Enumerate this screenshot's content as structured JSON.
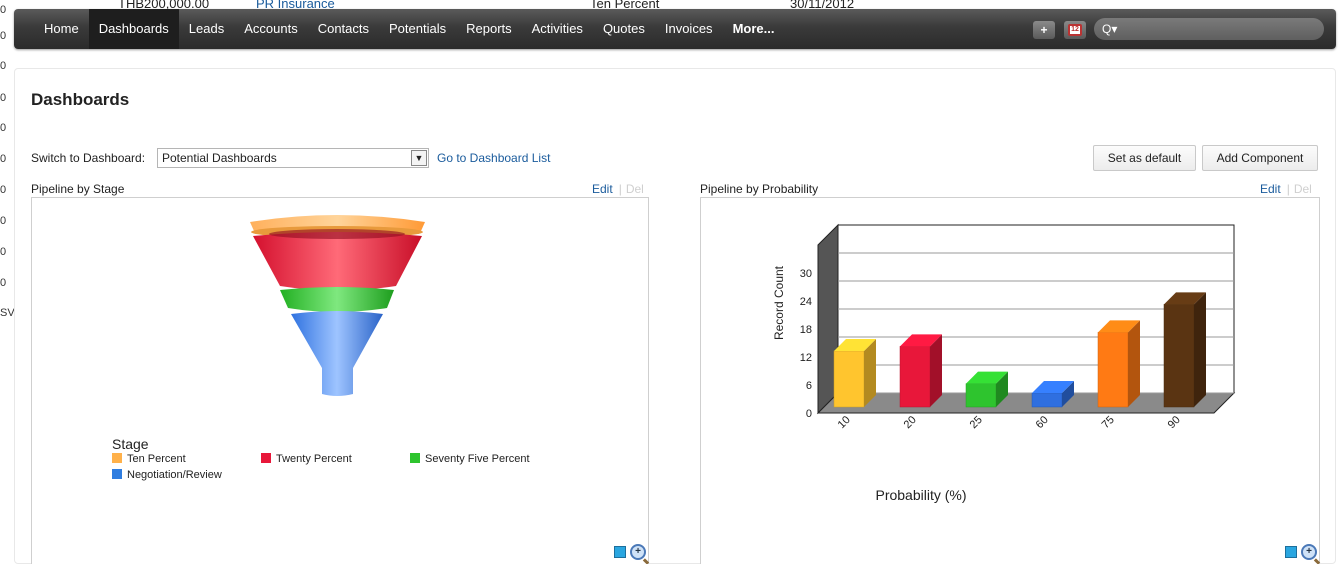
{
  "background": {
    "amount": "THB200,000.00",
    "account_link": "PR Insurance",
    "stage": "Ten Percent",
    "date": "30/11/2012",
    "left_fragments": [
      "0",
      "0",
      "0",
      "0",
      "0",
      "0",
      "0",
      "0",
      "0",
      "0",
      "SV"
    ]
  },
  "navbar": {
    "items": [
      {
        "label": "Home"
      },
      {
        "label": "Dashboards"
      },
      {
        "label": "Leads"
      },
      {
        "label": "Accounts"
      },
      {
        "label": "Contacts"
      },
      {
        "label": "Potentials"
      },
      {
        "label": "Reports"
      },
      {
        "label": "Activities"
      },
      {
        "label": "Quotes"
      },
      {
        "label": "Invoices"
      },
      {
        "label": "More..."
      }
    ],
    "active_index": 1,
    "add_button": "+",
    "search_icon": "Q▾"
  },
  "page": {
    "title": "Dashboards",
    "switch_label": "Switch to Dashboard:",
    "selected_dashboard": "Potential Dashboards",
    "go_to_list": "Go to Dashboard List",
    "set_default": "Set as default",
    "add_component": "Add Component"
  },
  "panels": {
    "left": {
      "title": "Pipeline by Stage",
      "edit": "Edit",
      "del": "Del"
    },
    "right": {
      "title": "Pipeline by Probability",
      "edit": "Edit",
      "del": "Del"
    }
  },
  "chart_data": [
    {
      "type": "funnel",
      "legend_title": "Stage",
      "series": [
        {
          "name": "Ten Percent",
          "color": "#ffb14a"
        },
        {
          "name": "Twenty Percent",
          "color": "#e8173a"
        },
        {
          "name": "Seventy Five Percent",
          "color": "#2ec42e"
        },
        {
          "name": "Negotiation/Review",
          "color": "#2f7de0"
        }
      ]
    },
    {
      "type": "bar",
      "xlabel": "Probability (%)",
      "ylabel": "Record Count",
      "categories": [
        "10",
        "20",
        "25",
        "60",
        "75",
        "90"
      ],
      "values": [
        12,
        13,
        5,
        3,
        16,
        22
      ],
      "colors": [
        "#ffc52e",
        "#e8173a",
        "#2ec42e",
        "#2f6fe0",
        "#ff7a14",
        "#5a3412"
      ],
      "yticks": [
        0,
        6,
        12,
        18,
        24,
        30
      ],
      "ylim": [
        0,
        36
      ]
    }
  ]
}
